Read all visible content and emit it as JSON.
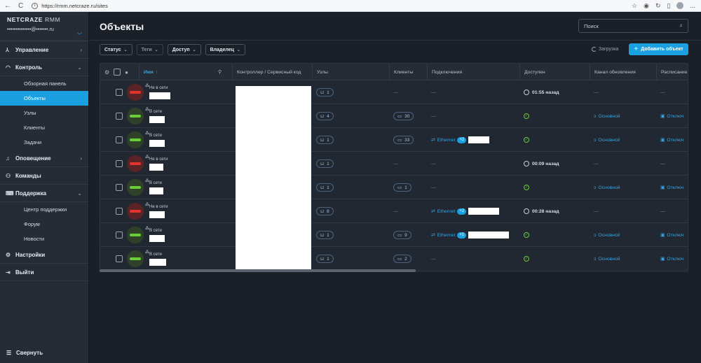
{
  "browser": {
    "url": "https://rmm.netcraze.ru/sites",
    "back": "←",
    "reload": "C",
    "more": "..."
  },
  "sidebar": {
    "brand": "NETCRAZE",
    "brand_suffix": "RMM",
    "user": "••••••••••••••@•••••••.ru",
    "items": [
      {
        "label": "Управление",
        "icon": "network-icon",
        "has_arrow": true
      },
      {
        "label": "Контроль",
        "icon": "gauge-icon",
        "has_arrow": true,
        "expanded": true,
        "children": [
          "Обзорная панель",
          "Объекты",
          "Узлы",
          "Клиенты",
          "Задачи"
        ]
      },
      {
        "label": "Оповещение",
        "icon": "bell-icon",
        "has_arrow": true
      },
      {
        "label": "Команды",
        "icon": "team-icon",
        "has_arrow": false
      },
      {
        "label": "Поддержка",
        "icon": "support-icon",
        "has_arrow": true,
        "expanded": true,
        "children": [
          "Центр поддержки",
          "Форум",
          "Новости"
        ]
      },
      {
        "label": "Настройки",
        "icon": "gear-icon",
        "has_arrow": false
      },
      {
        "label": "Выйти",
        "icon": "logout-icon",
        "has_arrow": false
      }
    ],
    "active_child": "Объекты",
    "collapse_label": "Свернуть"
  },
  "header": {
    "title": "Объекты",
    "search_placeholder": "Поиск"
  },
  "filters": [
    {
      "label": "Статус",
      "dim": false
    },
    {
      "label": "Теги",
      "dim": true
    },
    {
      "label": "Доступ",
      "dim": false
    },
    {
      "label": "Владелец",
      "dim": false
    }
  ],
  "loading_label": "Загрузка",
  "add_button": "Добавить объект",
  "columns": [
    "Имя",
    "Контроллер / Сервисный код",
    "Узлы",
    "Клиенты",
    "Подключения",
    "Доступен",
    "Канал обновления",
    "Расписание"
  ],
  "sort_arrow": "↑",
  "rows": [
    {
      "state": "off",
      "status": "Не в сети",
      "nodes": "1",
      "clients": "—",
      "conn": "—",
      "eth_badge": "",
      "avail": "01:55 назад",
      "avail_type": "time",
      "channel": "—",
      "schedule": "—"
    },
    {
      "state": "on",
      "status": "В сети",
      "nodes": "4",
      "clients": "30",
      "conn": "—",
      "eth_badge": "",
      "avail": "",
      "avail_type": "ok",
      "channel": "Основной",
      "schedule": "Отключ"
    },
    {
      "state": "on",
      "status": "В сети",
      "nodes": "1",
      "clients": "33",
      "conn": "Ethernet",
      "eth_badge": "+2",
      "avail": "",
      "avail_type": "ok",
      "channel": "Основной",
      "schedule": "Отключ"
    },
    {
      "state": "off",
      "status": "Не в сети",
      "nodes": "1",
      "clients": "—",
      "conn": "—",
      "eth_badge": "",
      "avail": "00:09 назад",
      "avail_type": "time",
      "channel": "—",
      "schedule": "—"
    },
    {
      "state": "on",
      "status": "В сети",
      "nodes": "1",
      "clients": "1",
      "conn": "—",
      "eth_badge": "",
      "avail": "",
      "avail_type": "ok",
      "channel": "Основной",
      "schedule": "Отключ"
    },
    {
      "state": "off",
      "status": "Не в сети",
      "nodes": "8",
      "clients": "—",
      "conn": "Ethernet",
      "eth_badge": "+2",
      "avail": "00:28 назад",
      "avail_type": "time",
      "channel": "—",
      "schedule": "—"
    },
    {
      "state": "on",
      "status": "В сети",
      "nodes": "1",
      "clients": "9",
      "conn": "Ethernet",
      "eth_badge": "+1",
      "avail": "",
      "avail_type": "ok",
      "channel": "Основной",
      "schedule": "Отключ"
    },
    {
      "state": "on",
      "status": "В сети",
      "nodes": "1",
      "clients": "2",
      "conn": "—",
      "eth_badge": "",
      "avail": "",
      "avail_type": "ok",
      "channel": "Основной",
      "schedule": "Отключ"
    }
  ],
  "colors": {
    "accent": "#1a9fe0",
    "online": "#6bcd3a",
    "offline": "#e2342f"
  }
}
